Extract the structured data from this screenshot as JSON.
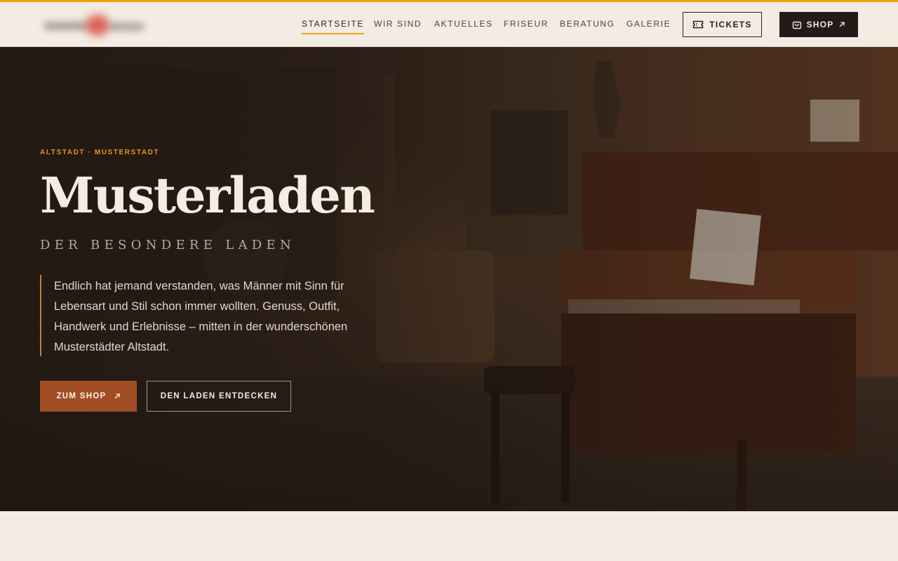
{
  "colors": {
    "accent": "#f59e0b",
    "header_bg": "#f2ece2",
    "dark": "#221b17",
    "cta_rust": "#a14e25",
    "hero_overlay": "#2d2119"
  },
  "header": {
    "logo_icon": "blurred-brand-logo",
    "nav": [
      {
        "label": "STARTSEITE",
        "active": true
      },
      {
        "label": "WIR SIND",
        "active": false
      },
      {
        "label": "AKTUELLES",
        "active": false
      },
      {
        "label": "FRISEUR",
        "active": false
      },
      {
        "label": "BERATUNG",
        "active": false
      },
      {
        "label": "GALERIE",
        "active": false
      }
    ],
    "tickets_label": "TICKETS",
    "tickets_icon": "ticket-icon",
    "shop_label": "SHOP",
    "shop_icon": "shopping-bag-icon"
  },
  "hero": {
    "eyebrow": "ALTSTADT · MUSTERSTADT",
    "title": "Musterladen",
    "subtitle": "DER BESONDERE LADEN",
    "intro": "Endlich hat jemand verstanden, was Männer mit Sinn für Lebensart und Stil schon immer wollten. Genuss, Outfit, Handwerk und Erlebnisse – mitten in der wunderschönen Musterstädter Altstadt.",
    "primary_cta": "ZUM SHOP",
    "secondary_cta": "DEN LADEN ENTDECKEN",
    "background_image": "shop-interior-with-piano"
  }
}
